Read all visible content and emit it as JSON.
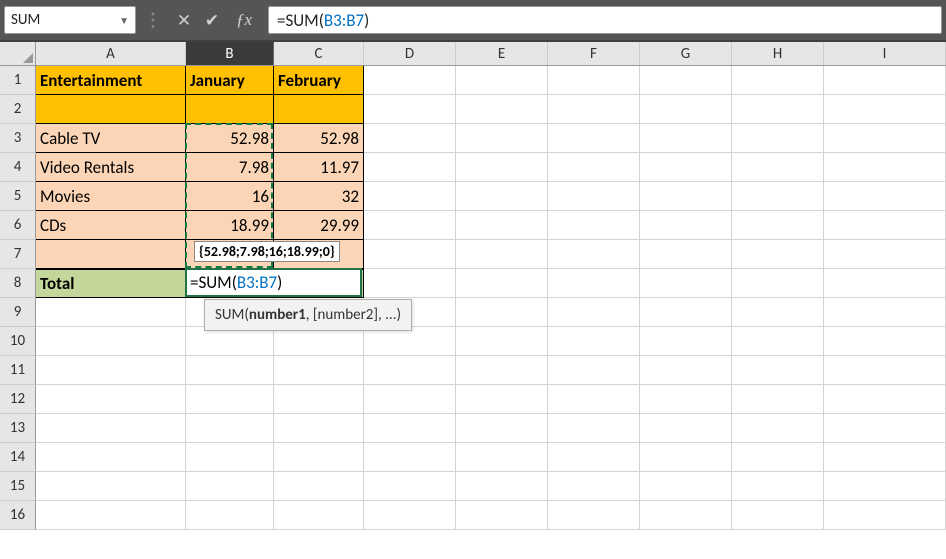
{
  "name_box": "SUM",
  "formula_bar": {
    "text": "=SUM(B3:B7)",
    "prefix": "=SUM(",
    "ref": "B3:B7",
    "suffix": ")"
  },
  "columns": [
    "A",
    "B",
    "C",
    "D",
    "E",
    "F",
    "G",
    "H",
    "I"
  ],
  "rows_shown": 16,
  "headers": {
    "A1": "Entertainment",
    "B1": "January",
    "C1": "February"
  },
  "categories": [
    "Cable TV",
    "Video Rentals",
    "Movies",
    "CDs"
  ],
  "data": {
    "B3": "52.98",
    "C3": "52.98",
    "B4": "7.98",
    "C4": "11.97",
    "B5": "16",
    "C5": "32",
    "B6": "18.99",
    "C6": "29.99"
  },
  "total_label": "Total",
  "editing_cell": {
    "address": "B8",
    "prefix": "=SUM(",
    "ref": "B3:B7",
    "suffix": ")"
  },
  "array_preview": "{52.98;7.98;16;18.99;0}",
  "fn_tip": {
    "name": "SUM",
    "arg1": "number1",
    "rest": ", [number2], ...)"
  },
  "colors": {
    "header_fill": "#ffc000",
    "data_fill": "#fbd5b5",
    "total_fill": "#c4d79b",
    "selection_green": "#217346",
    "ref_blue": "#0070c0"
  }
}
